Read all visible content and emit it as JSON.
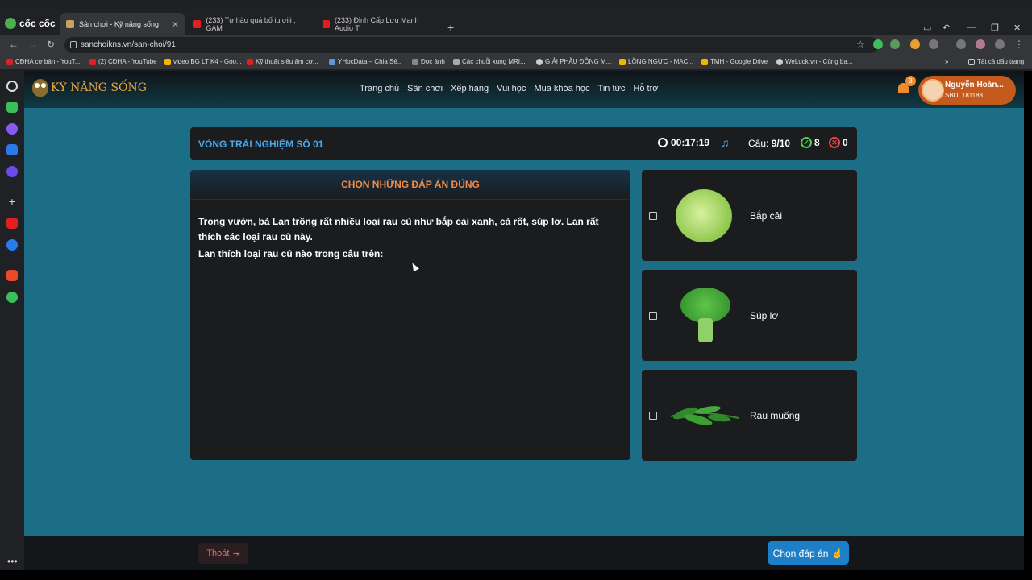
{
  "browser": {
    "brand": "cốc cốc",
    "tabs": [
      {
        "title": "Sân chơi - Kỹ năng sống",
        "active": true
      },
      {
        "title": "(233) Tự hào quá bố iu ơiii , GAM"
      },
      {
        "title": "(233) Đỉnh Cấp Lưu Manh Audio T"
      }
    ],
    "url": "sanchoikns.vn/san-choi/91",
    "bookmarks": [
      "CĐHA cơ bản - YouT...",
      "(2) CĐHA - YouTube",
      "video BG LT K4 - Goo...",
      "Kỹ thuật siêu âm cơ...",
      "YHocData – Chia Sẻ...",
      "Đọc ảnh",
      "Các chuỗi xung MRI...",
      "GIẢI PHẪU ĐỘNG M...",
      "LỒNG NGỰC - MAC...",
      "TMH - Google Drive",
      "WeLuck.vn - Cùng ba...",
      "Tất cả dấu trang"
    ]
  },
  "site": {
    "logo": "KỸ NĂNG SỐNG",
    "menu": [
      "Trang chủ",
      "Sân chơi",
      "Xếp hạng",
      "Vui học",
      "Mua khóa học",
      "Tin tức",
      "Hỗ trợ"
    ],
    "notifications": "3",
    "user": {
      "name": "Nguyễn Hoàn...",
      "sbd": "SBD: 181188"
    }
  },
  "round": {
    "title": "VÒNG TRẢI NGHIỆM SỐ 01",
    "timer": "00:17:19",
    "question_label": "Câu:",
    "question_num": "9/10",
    "correct": "8",
    "wrong": "0"
  },
  "question": {
    "header": "CHỌN NHỮNG ĐÁP ÁN ĐÚNG",
    "text": "Trong vườn, bà Lan trồng rất nhiều loại rau củ như bắp cải xanh, cà rốt, súp lơ. Lan rất thích các loại rau củ này.",
    "prompt": "Lan thích loại rau củ nào trong câu trên:"
  },
  "answers": [
    {
      "label": "Bắp cải",
      "icon": "cabbage-icon"
    },
    {
      "label": "Súp lơ",
      "icon": "broccoli-icon"
    },
    {
      "label": "Rau muống",
      "icon": "water-spinach-icon"
    }
  ],
  "footer": {
    "exit": "Thoát",
    "choose": "Chọn đáp án"
  },
  "colors": {
    "accent": "#1d7fc8",
    "page_bg": "#1b6e86",
    "panel": "#1a1c1e",
    "orange": "#f08a4a",
    "blue_title": "#48a8e8"
  }
}
